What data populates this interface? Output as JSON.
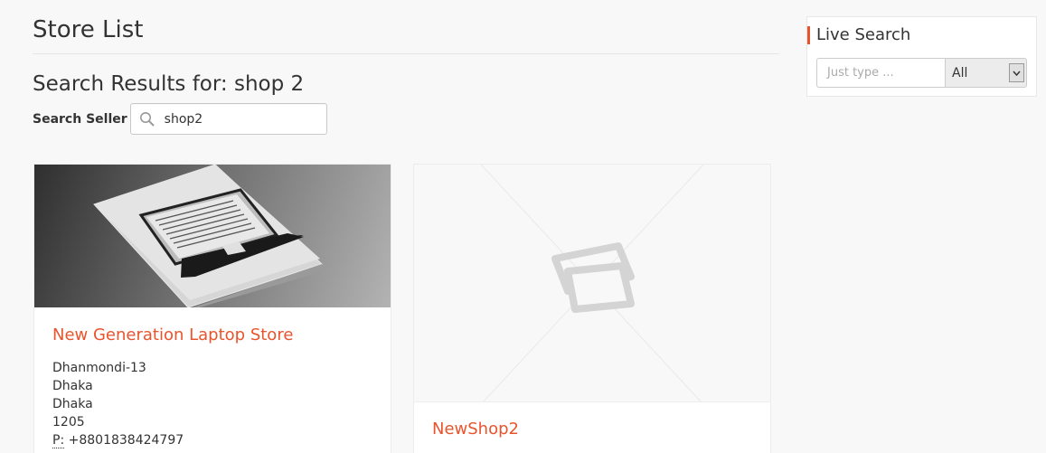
{
  "page": {
    "title": "Store List",
    "results_heading": "Search Results for: shop 2",
    "search_label": "Search Seller",
    "search_value": "shop2"
  },
  "stores": [
    {
      "name": "New Generation Laptop Store",
      "address_lines": [
        "Dhanmondi-13",
        "Dhaka",
        "Dhaka",
        "1205"
      ],
      "phone_label": "P:",
      "phone": "+8801838424797",
      "image": "laptop-photo"
    },
    {
      "name": "NewShop2",
      "image": "placeholder-image-icon"
    }
  ],
  "sidebar": {
    "widget_title": "Live Search",
    "input_placeholder": "Just type ...",
    "select_value": "All"
  },
  "colors": {
    "accent": "#e9542d",
    "background": "#f8f8f8"
  }
}
